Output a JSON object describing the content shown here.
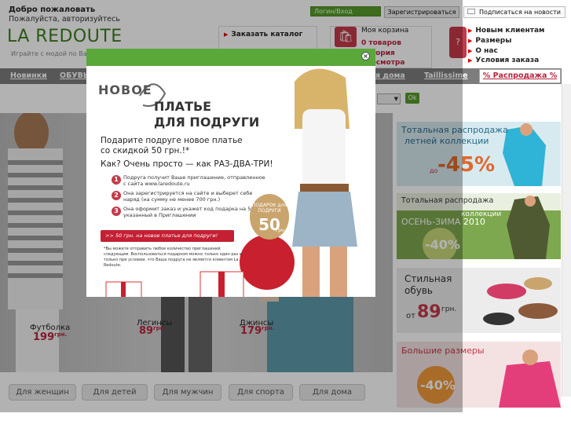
{
  "header": {
    "welcome": "Добро пожаловать",
    "login_hint": "Пожалуйста, авторизуйтесь",
    "logo": "LA REDOUTE",
    "tagline": "Играйте с модой по Ваше",
    "login_label": "Логин/Вход",
    "register_label": "Зарегистрироваться",
    "subscribe_label": "Подписаться на новости",
    "catalog_link": "Заказать каталог",
    "cart_title": "Моя корзина",
    "cart_items": "0 товаров",
    "cart_history": "История",
    "cart_views": "просмотра",
    "right_links": [
      "Новым клиентам",
      "Размеры",
      "О нас",
      "Условия заказа"
    ]
  },
  "nav": {
    "items": [
      "Новинки",
      "ОБУВЬ",
      "я дома",
      "Taillissime"
    ],
    "sale": "% Распродажа %",
    "ok": "Ok"
  },
  "hero": {
    "items": [
      {
        "name": "Футболка",
        "price": "199",
        "cur": "грн."
      },
      {
        "name": "Легинсы",
        "price": "89",
        "cur": "грн."
      },
      {
        "name": "Джинсы",
        "price": "179",
        "cur": "грн."
      }
    ],
    "categories": [
      "Для женщин",
      "Для детей",
      "Для мужчин",
      "Для спорта",
      "Для дома"
    ]
  },
  "promos": {
    "p1_line1": "Тотальная распродажа",
    "p1_line2": "летней коллекции",
    "p1_pre": "до",
    "p1_val": "-45%",
    "p2_line1": "Тотальная распродажа",
    "p2_line2": "коллекции",
    "p2_line3": "ОСЕНЬ-ЗИМА 2010",
    "p2_val": "-40%",
    "p3_line1": "Стильная",
    "p3_line2": "обувь",
    "p3_pre": "от",
    "p3_val": "89",
    "p3_cur": "грн.",
    "p4_line1": "Большие размеры",
    "p4_val": "-40%"
  },
  "modal": {
    "h1": "НОВОЕ",
    "h2": "ПЛАТЬЕ",
    "h3": "ДЛЯ ПОДРУГИ",
    "sub1": "Подарите подруге новое платье",
    "sub2": "со скидкой 50 грн.!*",
    "sub3": "Как? Очень просто — как РАЗ-ДВА-ТРИ!",
    "steps": [
      "Подруга получит Ваше приглашение, отправленное с сайта www.laredoute.ru",
      "Она зарегистрируется на сайте и выберет себе наряд (на сумму не менее 700 грн.)",
      "Она оформит заказ и укажет код подарка на 50грн, указанный в Приглашении"
    ],
    "cta": ">> 50 грн. на новое платье для подруги!",
    "fine": "*Вы можете отправить любое количество приглашений следующим. Воспользоваться подарком можно только один раз и только при условии, что Ваша подруга не является клиентом La Redoute.",
    "badge_text": "ПОДАРОК для ПОДРУГИ",
    "badge_val": "50",
    "badge_cur": "грн.",
    "close": "×"
  }
}
